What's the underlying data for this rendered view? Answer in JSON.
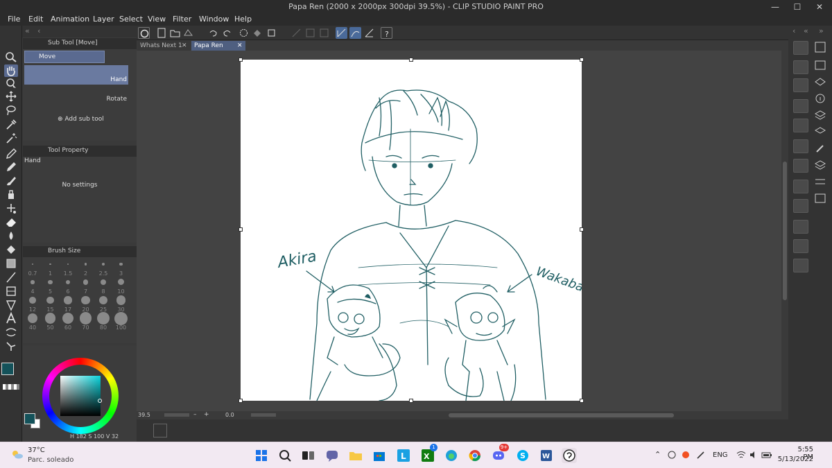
{
  "window": {
    "title": "Papa Ren (2000 x 2000px 300dpi 39.5%) - CLIP STUDIO PAINT PRO",
    "min": "—",
    "max": "☐",
    "close": "✕"
  },
  "menu": [
    "File",
    "Edit",
    "Animation",
    "Layer",
    "Select",
    "View",
    "Filter",
    "Window",
    "Help"
  ],
  "tabs": [
    {
      "label": "Whats Next 1",
      "close": "✕"
    },
    {
      "label": "Papa Ren",
      "close": "✕"
    }
  ],
  "subtool": {
    "header": "Sub Tool [Move]",
    "group": "Move",
    "items": [
      "Hand",
      "Rotate"
    ],
    "add": "Add sub tool"
  },
  "toolProperty": {
    "header": "Tool Property",
    "name": "Hand",
    "empty": "No settings"
  },
  "brushSize": {
    "header": "Brush Size",
    "sizes": [
      "0.7",
      "1",
      "1.5",
      "2",
      "2.5",
      "3",
      "4",
      "5",
      "6",
      "7",
      "8",
      "10",
      "12",
      "15",
      "17",
      "20",
      "25",
      "30",
      "40",
      "50",
      "60",
      "70",
      "80",
      "100"
    ]
  },
  "color": {
    "main": "#14525a",
    "sub": "#ffffff",
    "h_label": "H",
    "h": "182",
    "s_label": "S",
    "s": "100",
    "v_label": "V",
    "v": "32"
  },
  "statusbar": {
    "zoom": "39.5",
    "angle": "0.0"
  },
  "drawing": {
    "label_left": "Akira",
    "label_right": "Wakaba",
    "stroke": "#1f5e63"
  },
  "taskbar": {
    "weather_temp": "37°C",
    "weather_desc": "Parc. soleado",
    "lang": "ENG",
    "time": "5:55 PM",
    "date": "5/13/2022",
    "badge_edge": "1",
    "badge_discord": "9+"
  }
}
